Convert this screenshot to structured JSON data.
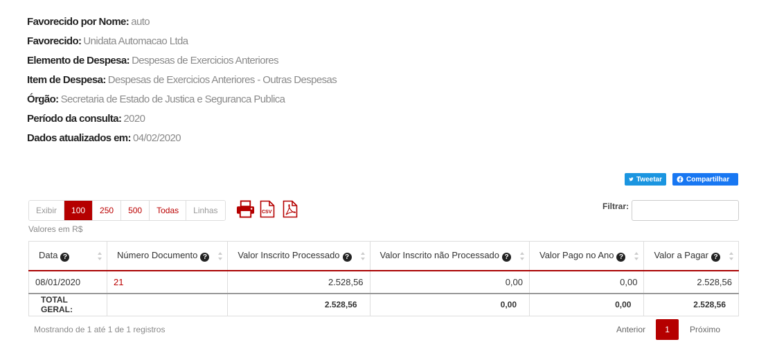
{
  "info": [
    {
      "label": "Favorecido por Nome:",
      "value": "auto"
    },
    {
      "label": "Favorecido:",
      "value": "Unidata Automacao Ltda"
    },
    {
      "label": "Elemento de Despesa:",
      "value": "Despesas de Exercicios Anteriores"
    },
    {
      "label": "Item de Despesa:",
      "value": "Despesas de Exercicios Anteriores - Outras Despesas"
    },
    {
      "label": "Órgão:",
      "value": "Secretaria de Estado de Justica e Seguranca Publica"
    },
    {
      "label": "Período da consulta:",
      "value": "2020"
    },
    {
      "label": "Dados atualizados em:",
      "value": "04/02/2020"
    }
  ],
  "social": {
    "tweet": "Tweetar",
    "share": "Compartilhar"
  },
  "lengths": {
    "exibir": "Exibir",
    "opt100": "100",
    "opt250": "250",
    "opt500": "500",
    "todas": "Todas",
    "linhas": "Linhas",
    "selected": "100"
  },
  "exports": {
    "print_icon": "print-icon",
    "csv_icon": "csv-icon",
    "pdf_icon": "pdf-icon",
    "csv_text": "CSV"
  },
  "units": "Valores em R$",
  "filter": {
    "label": "Filtrar:",
    "value": ""
  },
  "table": {
    "headers": [
      "Data",
      "Número Documento",
      "Valor Inscrito Processado",
      "Valor Inscrito não Processado",
      "Valor Pago no Ano",
      "Valor a Pagar"
    ],
    "rows": [
      [
        "08/01/2020",
        "21",
        "2.528,56",
        "0,00",
        "0,00",
        "2.528,56"
      ]
    ],
    "total": [
      "TOTAL GERAL:",
      "",
      "2.528,56",
      "0,00",
      "0,00",
      "2.528,56"
    ]
  },
  "footer": {
    "showing": "Mostrando de 1 até 1 de 1 registros",
    "prev": "Anterior",
    "page": "1",
    "next": "Próximo"
  },
  "colors": {
    "accent": "#b50000",
    "twitter": "#1b95e0",
    "facebook": "#1877f2"
  }
}
